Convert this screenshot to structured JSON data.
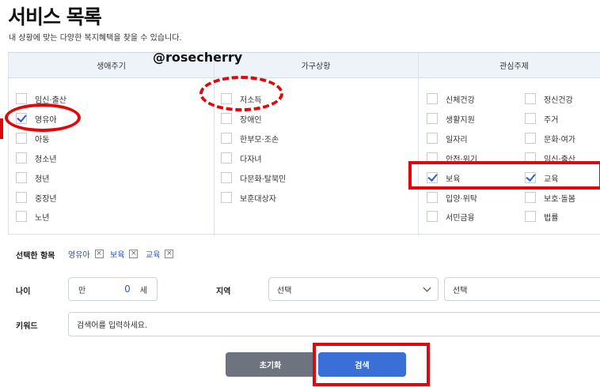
{
  "page": {
    "title": "서비스 목록",
    "subtitle": "내 상황에 맞는 다양한 복지혜택을 찾을 수 있습니다."
  },
  "watermark": "@rosecherry",
  "columns": {
    "life_cycle": {
      "header": "생애주기",
      "items": [
        {
          "label": "임신·출산",
          "checked": false
        },
        {
          "label": "영유아",
          "checked": true
        },
        {
          "label": "아동",
          "checked": false
        },
        {
          "label": "청소년",
          "checked": false
        },
        {
          "label": "청년",
          "checked": false
        },
        {
          "label": "중장년",
          "checked": false
        },
        {
          "label": "노년",
          "checked": false
        }
      ]
    },
    "household": {
      "header": "가구상황",
      "items": [
        {
          "label": "저소득",
          "checked": false
        },
        {
          "label": "장애인",
          "checked": false
        },
        {
          "label": "한부모·조손",
          "checked": false
        },
        {
          "label": "다자녀",
          "checked": false
        },
        {
          "label": "다문화·탈북민",
          "checked": false
        },
        {
          "label": "보훈대상자",
          "checked": false
        }
      ]
    },
    "interest": {
      "header": "관심주제",
      "items_left": [
        {
          "label": "신체건강",
          "checked": false
        },
        {
          "label": "생활지원",
          "checked": false
        },
        {
          "label": "일자리",
          "checked": false
        },
        {
          "label": "안전·위기",
          "checked": false
        },
        {
          "label": "보육",
          "checked": true
        },
        {
          "label": "입양·위탁",
          "checked": false
        },
        {
          "label": "서민금융",
          "checked": false
        }
      ],
      "items_right": [
        {
          "label": "정신건강",
          "checked": false
        },
        {
          "label": "주거",
          "checked": false
        },
        {
          "label": "문화·여가",
          "checked": false
        },
        {
          "label": "임신·출산",
          "checked": false
        },
        {
          "label": "교육",
          "checked": true
        },
        {
          "label": "보호·돌봄",
          "checked": false
        },
        {
          "label": "법률",
          "checked": false
        }
      ]
    }
  },
  "selected": {
    "label": "선택한 항목",
    "tags": [
      "영유아",
      "보육",
      "교육"
    ]
  },
  "form": {
    "age_label": "나이",
    "age_prefix": "만",
    "age_value": "0",
    "age_unit": "세",
    "region_label": "지역",
    "region_select_1": "선택",
    "region_select_2": "선택",
    "keyword_label": "키워드",
    "keyword_placeholder": "검색어를 입력하세요."
  },
  "buttons": {
    "reset": "초기화",
    "search": "검색"
  },
  "colors": {
    "accent_blue": "#3b6fd8",
    "reset_gray": "#6e7380",
    "highlight_red": "#e0080b",
    "header_bg": "#eef3fa"
  }
}
